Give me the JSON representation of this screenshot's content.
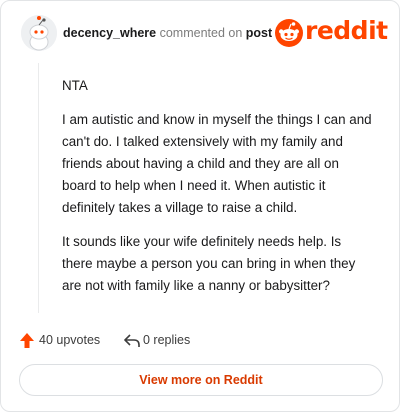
{
  "header": {
    "username": "decency_where",
    "commented_on": "commented on",
    "post_link": "post",
    "logo_text": "reddit"
  },
  "comment": {
    "paragraphs": [
      "NTA",
      "I am autistic and know in myself the things I can and can't do. I talked extensively with my family and friends about having a child and they are all on board to help when I need it. When autistic it definitely takes a village to raise a child.",
      "It sounds like your wife definitely needs help. Is there maybe a person you can bring in when they are not with family like a nanny or babysitter?"
    ]
  },
  "actions": {
    "upvotes": "40 upvotes",
    "replies": "0 replies"
  },
  "footer": {
    "view_more": "View more on Reddit"
  },
  "colors": {
    "brand": "#ff4500",
    "link": "#d93a00"
  },
  "icons": [
    "avatar-snoo",
    "reddit-snoo-icon",
    "upvote-arrow-icon",
    "reply-icon"
  ]
}
